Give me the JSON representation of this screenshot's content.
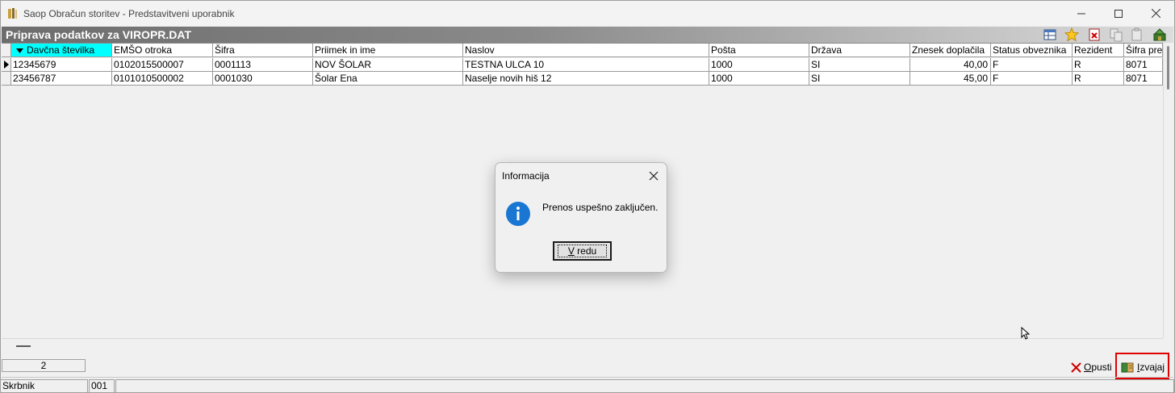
{
  "window": {
    "title": "Saop Obračun storitev - Predstavitveni uporabnik"
  },
  "section": {
    "title": "Priprava podatkov za VIROPR.DAT"
  },
  "grid": {
    "columns": [
      {
        "label": "Davčna številka",
        "sorted": true
      },
      {
        "label": "EMŠO otroka"
      },
      {
        "label": "Šifra"
      },
      {
        "label": "Priimek in ime"
      },
      {
        "label": "Naslov"
      },
      {
        "label": "Pošta"
      },
      {
        "label": "Država"
      },
      {
        "label": "Znesek doplačila"
      },
      {
        "label": "Status obveznika"
      },
      {
        "label": "Rezident"
      },
      {
        "label": "Šifra pre"
      }
    ],
    "rows": [
      {
        "davcna": "12345679",
        "emso": "0102015500007",
        "sifra": "0001113",
        "ime": "NOV ŠOLAR",
        "naslov": "TESTNA ULCA 10",
        "posta": "1000",
        "drzava": "SI",
        "znesek": "40,00",
        "status": "F",
        "rezident": "R",
        "sifra_pre": "8071"
      },
      {
        "davcna": "23456787",
        "emso": "0101010500002",
        "sifra": "0001030",
        "ime": "Šolar Ena",
        "naslov": "Naselje novih hiš 12",
        "posta": "1000",
        "drzava": "SI",
        "znesek": "45,00",
        "status": "F",
        "rezident": "R",
        "sifra_pre": "8071"
      }
    ]
  },
  "footer": {
    "count": "2",
    "status_label": "Skrbnik",
    "status_code": "001",
    "cancel_label": "Opusti",
    "cancel_mnemonic": "O",
    "cancel_rest": "pusti",
    "execute_mnemonic": "I",
    "execute_rest": "zvajaj"
  },
  "dialog": {
    "title": "Informacija",
    "message": "Prenos uspešno zaključen.",
    "ok_mnemonic": "V",
    "ok_rest": " redu"
  },
  "icons": {
    "app": "book-icon",
    "toolbar": [
      "columns-icon",
      "star-icon",
      "delete-icon",
      "copy-icon",
      "paste-icon",
      "exit-icon"
    ],
    "dialog": "info-icon"
  },
  "colors": {
    "sorted_header": "#00ffff",
    "highlight_box": "#e00000",
    "info_blue": "#1976d2"
  }
}
